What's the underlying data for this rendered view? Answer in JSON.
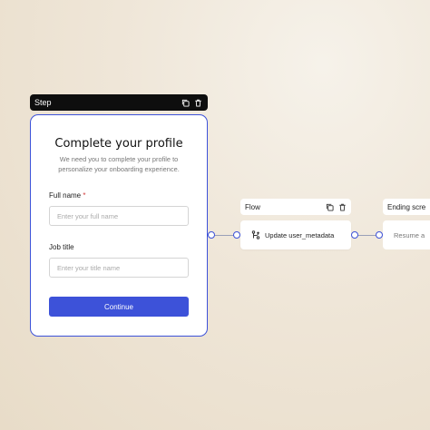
{
  "step": {
    "header_label": "Step",
    "title": "Complete your profile",
    "subtitle": "We need you to complete your profile to personalize your onboarding experience.",
    "fields": [
      {
        "label": "Full name",
        "required_mark": "*",
        "placeholder": "Enter your full name"
      },
      {
        "label": "Job title",
        "placeholder": "Enter your title name"
      }
    ],
    "continue_label": "Continue",
    "header_icons": [
      "copy-icon",
      "trash-icon"
    ]
  },
  "flow": {
    "header_label": "Flow",
    "node_label": "Update user_metadata",
    "node_icon": "branch-icon",
    "header_icons": [
      "copy-icon",
      "trash-icon"
    ]
  },
  "ending": {
    "header_label": "Ending scre",
    "node_label": "Resume a"
  },
  "colors": {
    "accent": "#3d52d9",
    "header_dark": "#0e0e0e",
    "required": "#d23b3b"
  }
}
